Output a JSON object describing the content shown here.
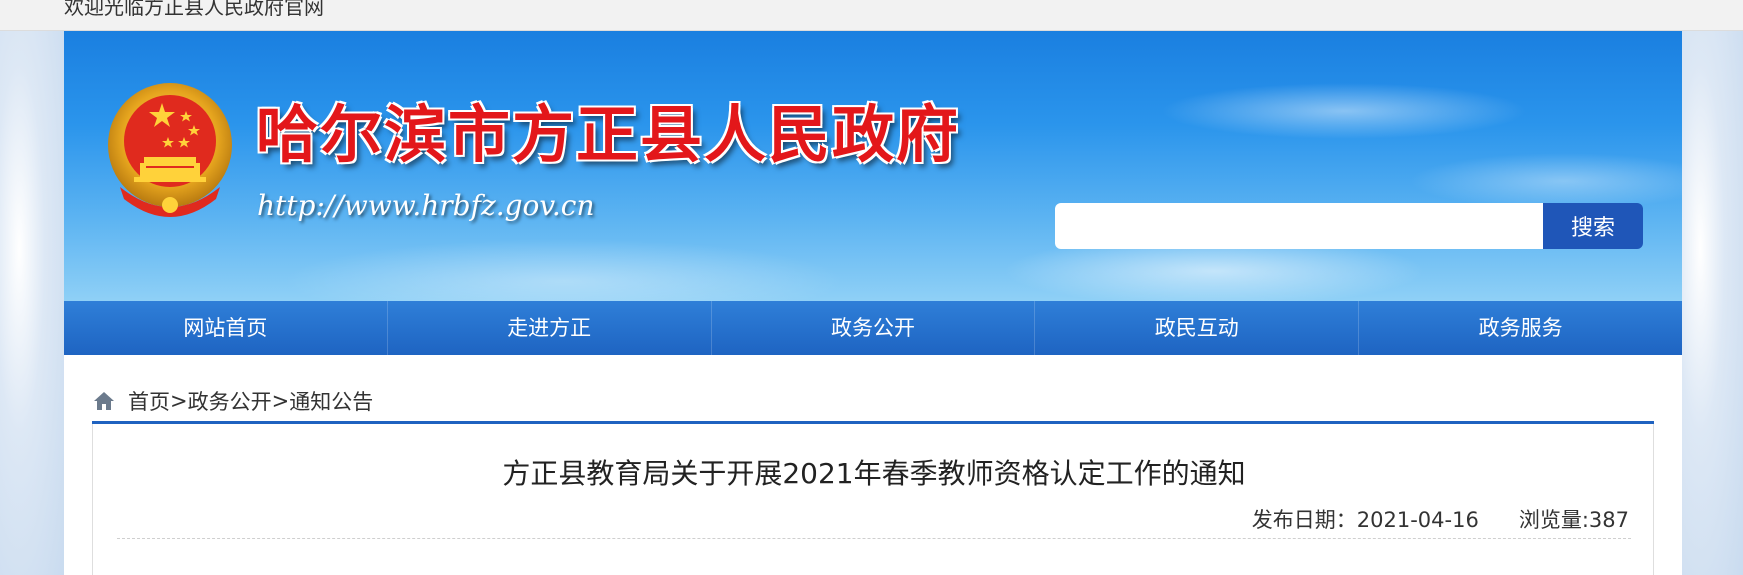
{
  "topbar": {
    "welcome": "欢迎光临方正县人民政府官网"
  },
  "header": {
    "site_title": "哈尔滨市方正县人民政府",
    "site_url": "http://www.hrbfz.gov.cn",
    "search": {
      "placeholder": "",
      "value": "",
      "button_label": "搜索"
    }
  },
  "nav": {
    "items": [
      {
        "label": "网站首页"
      },
      {
        "label": "走进方正"
      },
      {
        "label": "政务公开"
      },
      {
        "label": "政民互动"
      },
      {
        "label": "政务服务"
      }
    ]
  },
  "breadcrumb": {
    "items": [
      {
        "label": "首页"
      },
      {
        "label": "政务公开"
      },
      {
        "label": "通知公告"
      }
    ],
    "separator": ">"
  },
  "article": {
    "title": "方正县教育局关于开展2021年春季教师资格认定工作的通知",
    "publish_date_label": "发布日期：",
    "publish_date": "2021-04-16",
    "views_label": "浏览量:",
    "views": "387"
  },
  "colors": {
    "nav_bg": "#1e64c2",
    "search_button": "#1f56b8",
    "title_red": "#e3171a",
    "accent_line": "#1f62c0"
  }
}
